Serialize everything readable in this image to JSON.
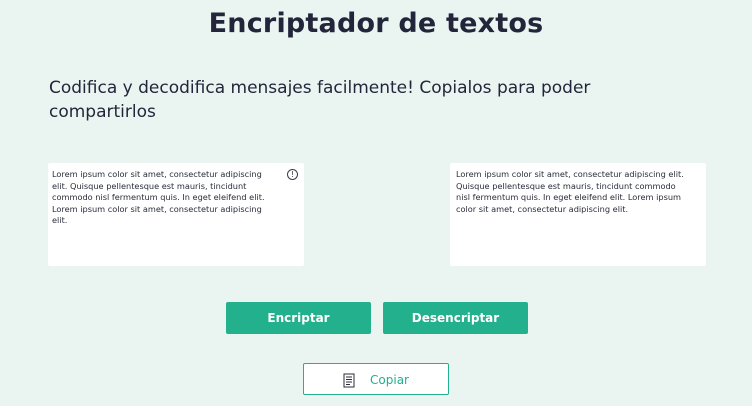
{
  "header": {
    "title": "Encriptador de textos",
    "subtitle": "Codifica y decodifica mensajes facilmente! Copialos para poder compartirlos"
  },
  "input_box": {
    "text": "Lorem ipsum color sit amet, consectetur adipiscing elit. Quisque pellentesque est mauris, tincidunt commodo nisl fermentum quis. In eget eleifend elit. Lorem ipsum color sit amet, consectetur adipiscing elit.",
    "info_icon": "info-icon"
  },
  "output_box": {
    "text": "Lorem ipsum color sit amet, consectetur adipiscing elit. Quisque pellentesque est mauris, tincidunt commodo nisl fermentum quis. In eget eleifend elit. Lorem ipsum color sit amet, consectetur adipiscing elit."
  },
  "actions": {
    "encrypt_label": "Encriptar",
    "decrypt_label": "Desencriptar",
    "copy_label": "Copiar",
    "copy_icon": "document-icon"
  },
  "colors": {
    "background": "#eaf5f1",
    "accent": "#23b08c",
    "text": "#23263a"
  }
}
